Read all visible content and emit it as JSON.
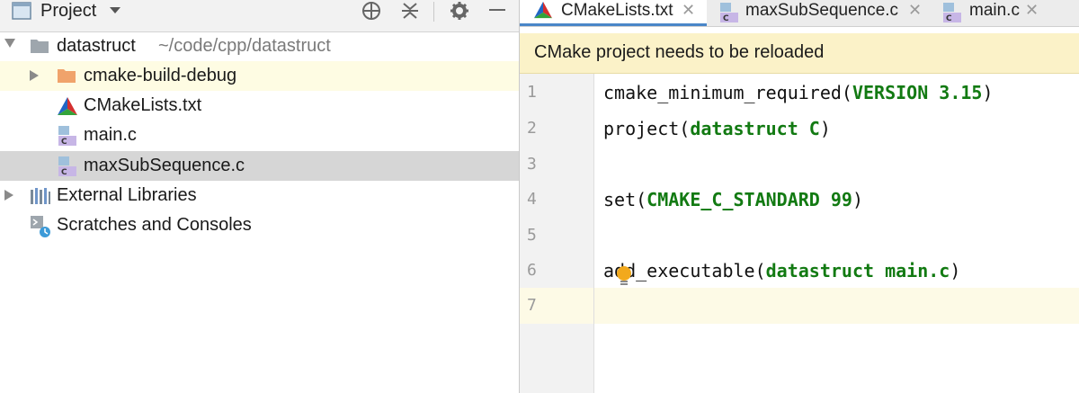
{
  "project_panel": {
    "title": "Project",
    "tree": [
      {
        "name": "datastruct",
        "path": "~/code/cpp/datastruct",
        "expanded": true,
        "icon": "folder-icon"
      },
      {
        "name": "cmake-build-debug",
        "icon": "orange-folder-icon"
      },
      {
        "name": "CMakeLists.txt",
        "icon": "cmake-icon"
      },
      {
        "name": "main.c",
        "icon": "c-file-icon"
      },
      {
        "name": "maxSubSequence.c",
        "icon": "c-file-icon",
        "selected": true
      },
      {
        "name": "External Libraries",
        "icon": "libraries-icon"
      },
      {
        "name": "Scratches and Consoles",
        "icon": "scratches-icon"
      }
    ]
  },
  "editor": {
    "tabs": [
      {
        "label": "CMakeLists.txt",
        "active": true
      },
      {
        "label": "maxSubSequence.c"
      },
      {
        "label": "main.c"
      }
    ],
    "notification": "CMake project needs to be reloaded",
    "current_line": 7,
    "lines": [
      {
        "n": "1",
        "text": "cmake_minimum_required(VERSION 3.15)"
      },
      {
        "n": "2",
        "text": "project(datastruct C)"
      },
      {
        "n": "3",
        "text": ""
      },
      {
        "n": "4",
        "text": "set(CMAKE_C_STANDARD 99)"
      },
      {
        "n": "5",
        "text": ""
      },
      {
        "n": "6",
        "text": "add_executable(datastruct main.c)"
      },
      {
        "n": "7",
        "text": ""
      }
    ]
  },
  "colors": {
    "keyword": "#127a12",
    "notice_bg": "#fbf2c8",
    "selected_row": "#d6d6d6",
    "current_line_bg": "#fdfae6"
  }
}
